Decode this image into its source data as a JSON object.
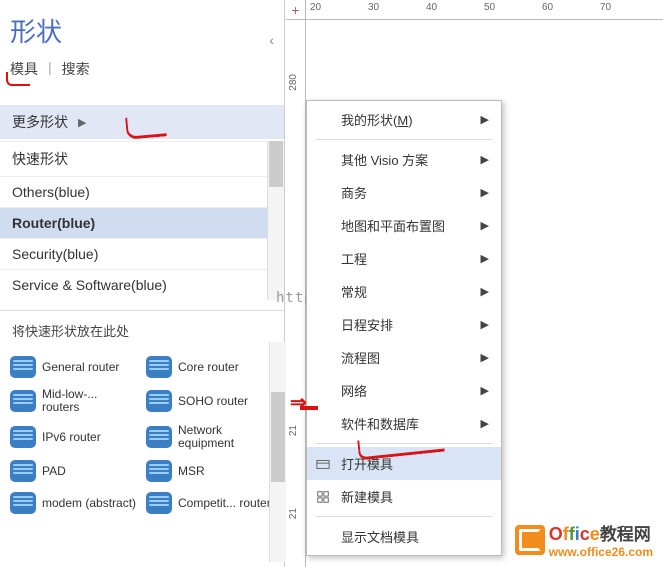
{
  "panel": {
    "title": "形状",
    "tabs": {
      "stencils": "模具",
      "search": "搜索"
    },
    "more_shapes": "更多形状",
    "drop_hint": "将快速形状放在此处",
    "stencils": [
      {
        "label": "快速形状",
        "selected": false
      },
      {
        "label": "Others(blue)",
        "selected": false
      },
      {
        "label": "Router(blue)",
        "selected": true
      },
      {
        "label": "Security(blue)",
        "selected": false
      },
      {
        "label": "Service & Software(blue)",
        "selected": false
      }
    ],
    "shapes": [
      {
        "label": "General router"
      },
      {
        "label": "Core router"
      },
      {
        "label": "Mid-low-... routers"
      },
      {
        "label": "SOHO router"
      },
      {
        "label": "IPv6 router"
      },
      {
        "label": "Network equipment"
      },
      {
        "label": "PAD"
      },
      {
        "label": "MSR"
      },
      {
        "label": "modem (abstract)"
      },
      {
        "label": "Competit... router"
      }
    ]
  },
  "ruler": {
    "corner": "+",
    "h_ticks": [
      "20",
      "30",
      "40",
      "50",
      "60",
      "70"
    ],
    "v_ticks": [
      "280",
      "21",
      "21"
    ]
  },
  "menu": {
    "items": [
      {
        "label": "我的形状(",
        "short": "M",
        "tail": ")",
        "sub": true
      },
      {
        "sep": true
      },
      {
        "label": "其他 Visio 方案",
        "sub": true
      },
      {
        "label": "商务",
        "sub": true
      },
      {
        "label": "地图和平面布置图",
        "sub": true
      },
      {
        "label": "工程",
        "sub": true
      },
      {
        "label": "常规",
        "sub": true
      },
      {
        "label": "日程安排",
        "sub": true
      },
      {
        "label": "流程图",
        "sub": true
      },
      {
        "label": "网络",
        "sub": true
      },
      {
        "label": "软件和数据库",
        "sub": true
      },
      {
        "sep": true
      },
      {
        "label": "打开模具",
        "icon": "open",
        "hover": true
      },
      {
        "label": "新建模具",
        "icon": "new"
      },
      {
        "sep": true
      },
      {
        "label": "显示文档模具"
      }
    ]
  },
  "watermark": "http://blog.csdn.net/",
  "brand": {
    "name": "Office",
    "cn": "教程网",
    "url": "www.office26.com"
  }
}
